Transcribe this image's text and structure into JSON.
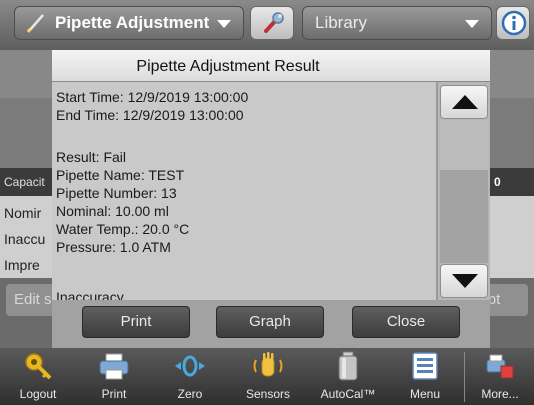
{
  "header": {
    "app_select_label": "Pipette Adjustment",
    "library_select_label": "Library",
    "icons": {
      "pencil": "pencil-icon",
      "wrench": "wrench-icon",
      "info": "info-icon"
    }
  },
  "background_screen": {
    "capacity_label": "Capacit",
    "right_col_fragment": "0",
    "rows": [
      "Nomir",
      "Inaccu",
      "Impre"
    ],
    "left_button": "Edit s",
    "right_button": "pt"
  },
  "dialog": {
    "title": "Pipette Adjustment Result",
    "lines": {
      "start_time": "Start Time: 12/9/2019  13:00:00",
      "end_time": "End Time: 12/9/2019  13:00:00",
      "result": "Result: Fail",
      "pipette_name": "Pipette Name: TEST",
      "pipette_number": "Pipette Number: 13",
      "nominal": "Nominal: 10.00 ml",
      "water_temp": "Water Temp.: 20.0 °C",
      "pressure": "Pressure: 1.0 ATM",
      "inaccuracy": "Inaccuracy"
    },
    "buttons": {
      "print": "Print",
      "graph": "Graph",
      "close": "Close"
    }
  },
  "toolbar": {
    "items": [
      {
        "label": "Logout",
        "icon": "key-icon"
      },
      {
        "label": "Print",
        "icon": "printer-icon"
      },
      {
        "label": "Zero",
        "icon": "zero-icon"
      },
      {
        "label": "Sensors",
        "icon": "sensor-hand-icon"
      },
      {
        "label": "AutoCal™",
        "icon": "calibration-weight-icon"
      },
      {
        "label": "Menu",
        "icon": "menu-list-icon"
      },
      {
        "label": "More...",
        "icon": "more-icon"
      }
    ]
  },
  "colors": {
    "dialog_content_bg": "#c9c9c9",
    "button_dark": "#4a4a4a",
    "toolbar_bg": "#3a3a3a",
    "key_yellow": "#e8b820",
    "zero_blue": "#4aa8e0"
  }
}
